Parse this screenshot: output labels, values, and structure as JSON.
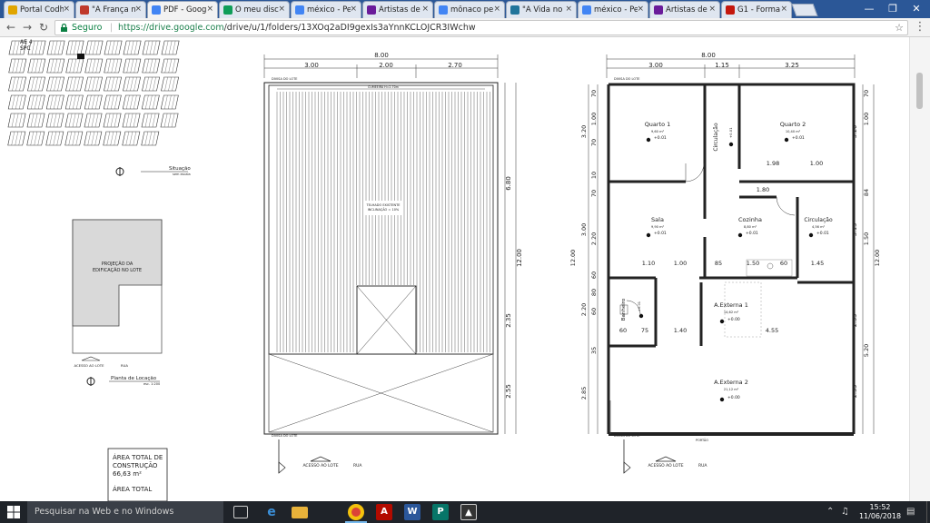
{
  "browser": {
    "tabs": [
      {
        "title": "Portal Codh",
        "favicon": "page-icon",
        "color": "#e0a500"
      },
      {
        "title": "\"A França n",
        "favicon": "book-icon",
        "color": "#c0392b"
      },
      {
        "title": "PDF - Goog",
        "favicon": "drive-icon",
        "color": "#4285f4",
        "active": true
      },
      {
        "title": "O meu disc",
        "favicon": "drive-icon",
        "color": "#0f9d58"
      },
      {
        "title": "méxico - Pe",
        "favicon": "google-icon",
        "color": "#4285f4"
      },
      {
        "title": "Artistas de",
        "favicon": "ftc-icon",
        "color": "#6a1b9a"
      },
      {
        "title": "mônaco per",
        "favicon": "google-icon",
        "color": "#4285f4"
      },
      {
        "title": "\"A Vida no",
        "favicon": "wordpress-icon",
        "color": "#21759b"
      },
      {
        "title": "méxico - Pe",
        "favicon": "google-icon",
        "color": "#4285f4"
      },
      {
        "title": "Artistas de",
        "favicon": "ftc-icon",
        "color": "#6a1b9a"
      },
      {
        "title": "G1 - Forma",
        "favicon": "g1-icon",
        "color": "#c4170c"
      }
    ],
    "secure_label": "Seguro",
    "url": "https://drive.google.com",
    "url_path": "/drive/u/1/folders/13XOq2aDI9gexIs3aYnnKCLOJCR3IWchw"
  },
  "drawing": {
    "site_tags": [
      "AE 4",
      "SPC"
    ],
    "situacao_label": "Situação",
    "situacao_scale": "sem escala",
    "projecao_label": "PROJEÇÃO DA EDIFICAÇÃO NO LOTE",
    "acesso_lote_small": "ACESSO AO LOTE",
    "rua_small": "RUA",
    "planta_locacao_label": "Planta de Locação",
    "planta_locacao_scale": "esc. 1:200",
    "area_box": {
      "lines": [
        "ÁREA TOTAL DE",
        "CONSTRUÇÃO",
        "66,63 m²",
        "",
        "ÁREA TOTAL"
      ]
    },
    "roof": {
      "top_dims": [
        "8.00",
        "3.00",
        "2.00",
        "2.70"
      ],
      "side_dims": [
        "6.80",
        "2.35",
        "2.55"
      ],
      "total_side": "12.00",
      "divisa": "DIVISA DO LOTE",
      "cumeeira": "CUMEEIRA H=2.70m",
      "telhado": [
        "TELHADO EXISTENTE",
        "INCLINAÇÃO = 10%"
      ],
      "acesso": "ACESSO AO LOTE",
      "rua": "RUA"
    },
    "plan": {
      "top_dims": [
        "8.00",
        "3.00",
        "1.15",
        "3.25"
      ],
      "rooms": [
        {
          "name": "Quarto 1",
          "area": "9,60 m²",
          "level": "+0.01"
        },
        {
          "name": "Quarto 2",
          "area": "10,40 m²",
          "level": "+0.01"
        },
        {
          "name": "Circulação",
          "area": "",
          "level": "+0.01"
        },
        {
          "name": "Sala",
          "area": "9,90 m²",
          "level": "+0.01"
        },
        {
          "name": "Cozinha",
          "area": "8,80 m²",
          "level": "+0.01"
        },
        {
          "name": "Circulação",
          "area": "4,56 m²",
          "level": "+0.01"
        },
        {
          "name": "Banheiro",
          "area": "",
          "level": "+0.01"
        },
        {
          "name": "A.Externa 1",
          "area": "14,62 m²",
          "level": "+0.00"
        },
        {
          "name": "A.Externa 2",
          "area": "21,12 m²",
          "level": "+0.00"
        }
      ],
      "inner_dims": [
        "1.98",
        "1.00",
        "1.80",
        "1.10",
        "1.00",
        "85",
        "1.50",
        "60",
        "1.45",
        "60",
        "75",
        "1.40",
        "4.55"
      ],
      "left_dims": [
        "70",
        "1.00",
        "70",
        "3.20",
        "10",
        "70",
        "2.20",
        "3.00",
        "60",
        "80",
        "2.20",
        "60",
        "35",
        "2.85",
        "12.00"
      ],
      "right_dims": [
        "70",
        "1.00",
        "3.20",
        "84",
        "3.15",
        "1.50",
        "2.35",
        "5.20",
        "2.55",
        "12.00"
      ],
      "divisa": "DIVISA DO LOTE",
      "portao": "PORTÃO",
      "acesso": "ACESSO AO LOTE",
      "rua": "RUA"
    }
  },
  "taskbar": {
    "search_placeholder": "Pesquisar na Web e no Windows",
    "time": "15:52",
    "date": "11/06/2018",
    "apps": [
      "task-view-icon",
      "edge-icon",
      "explorer-icon",
      "chrome-icon",
      "acrobat-icon",
      "word-icon",
      "publisher-icon",
      "photos-icon"
    ]
  }
}
